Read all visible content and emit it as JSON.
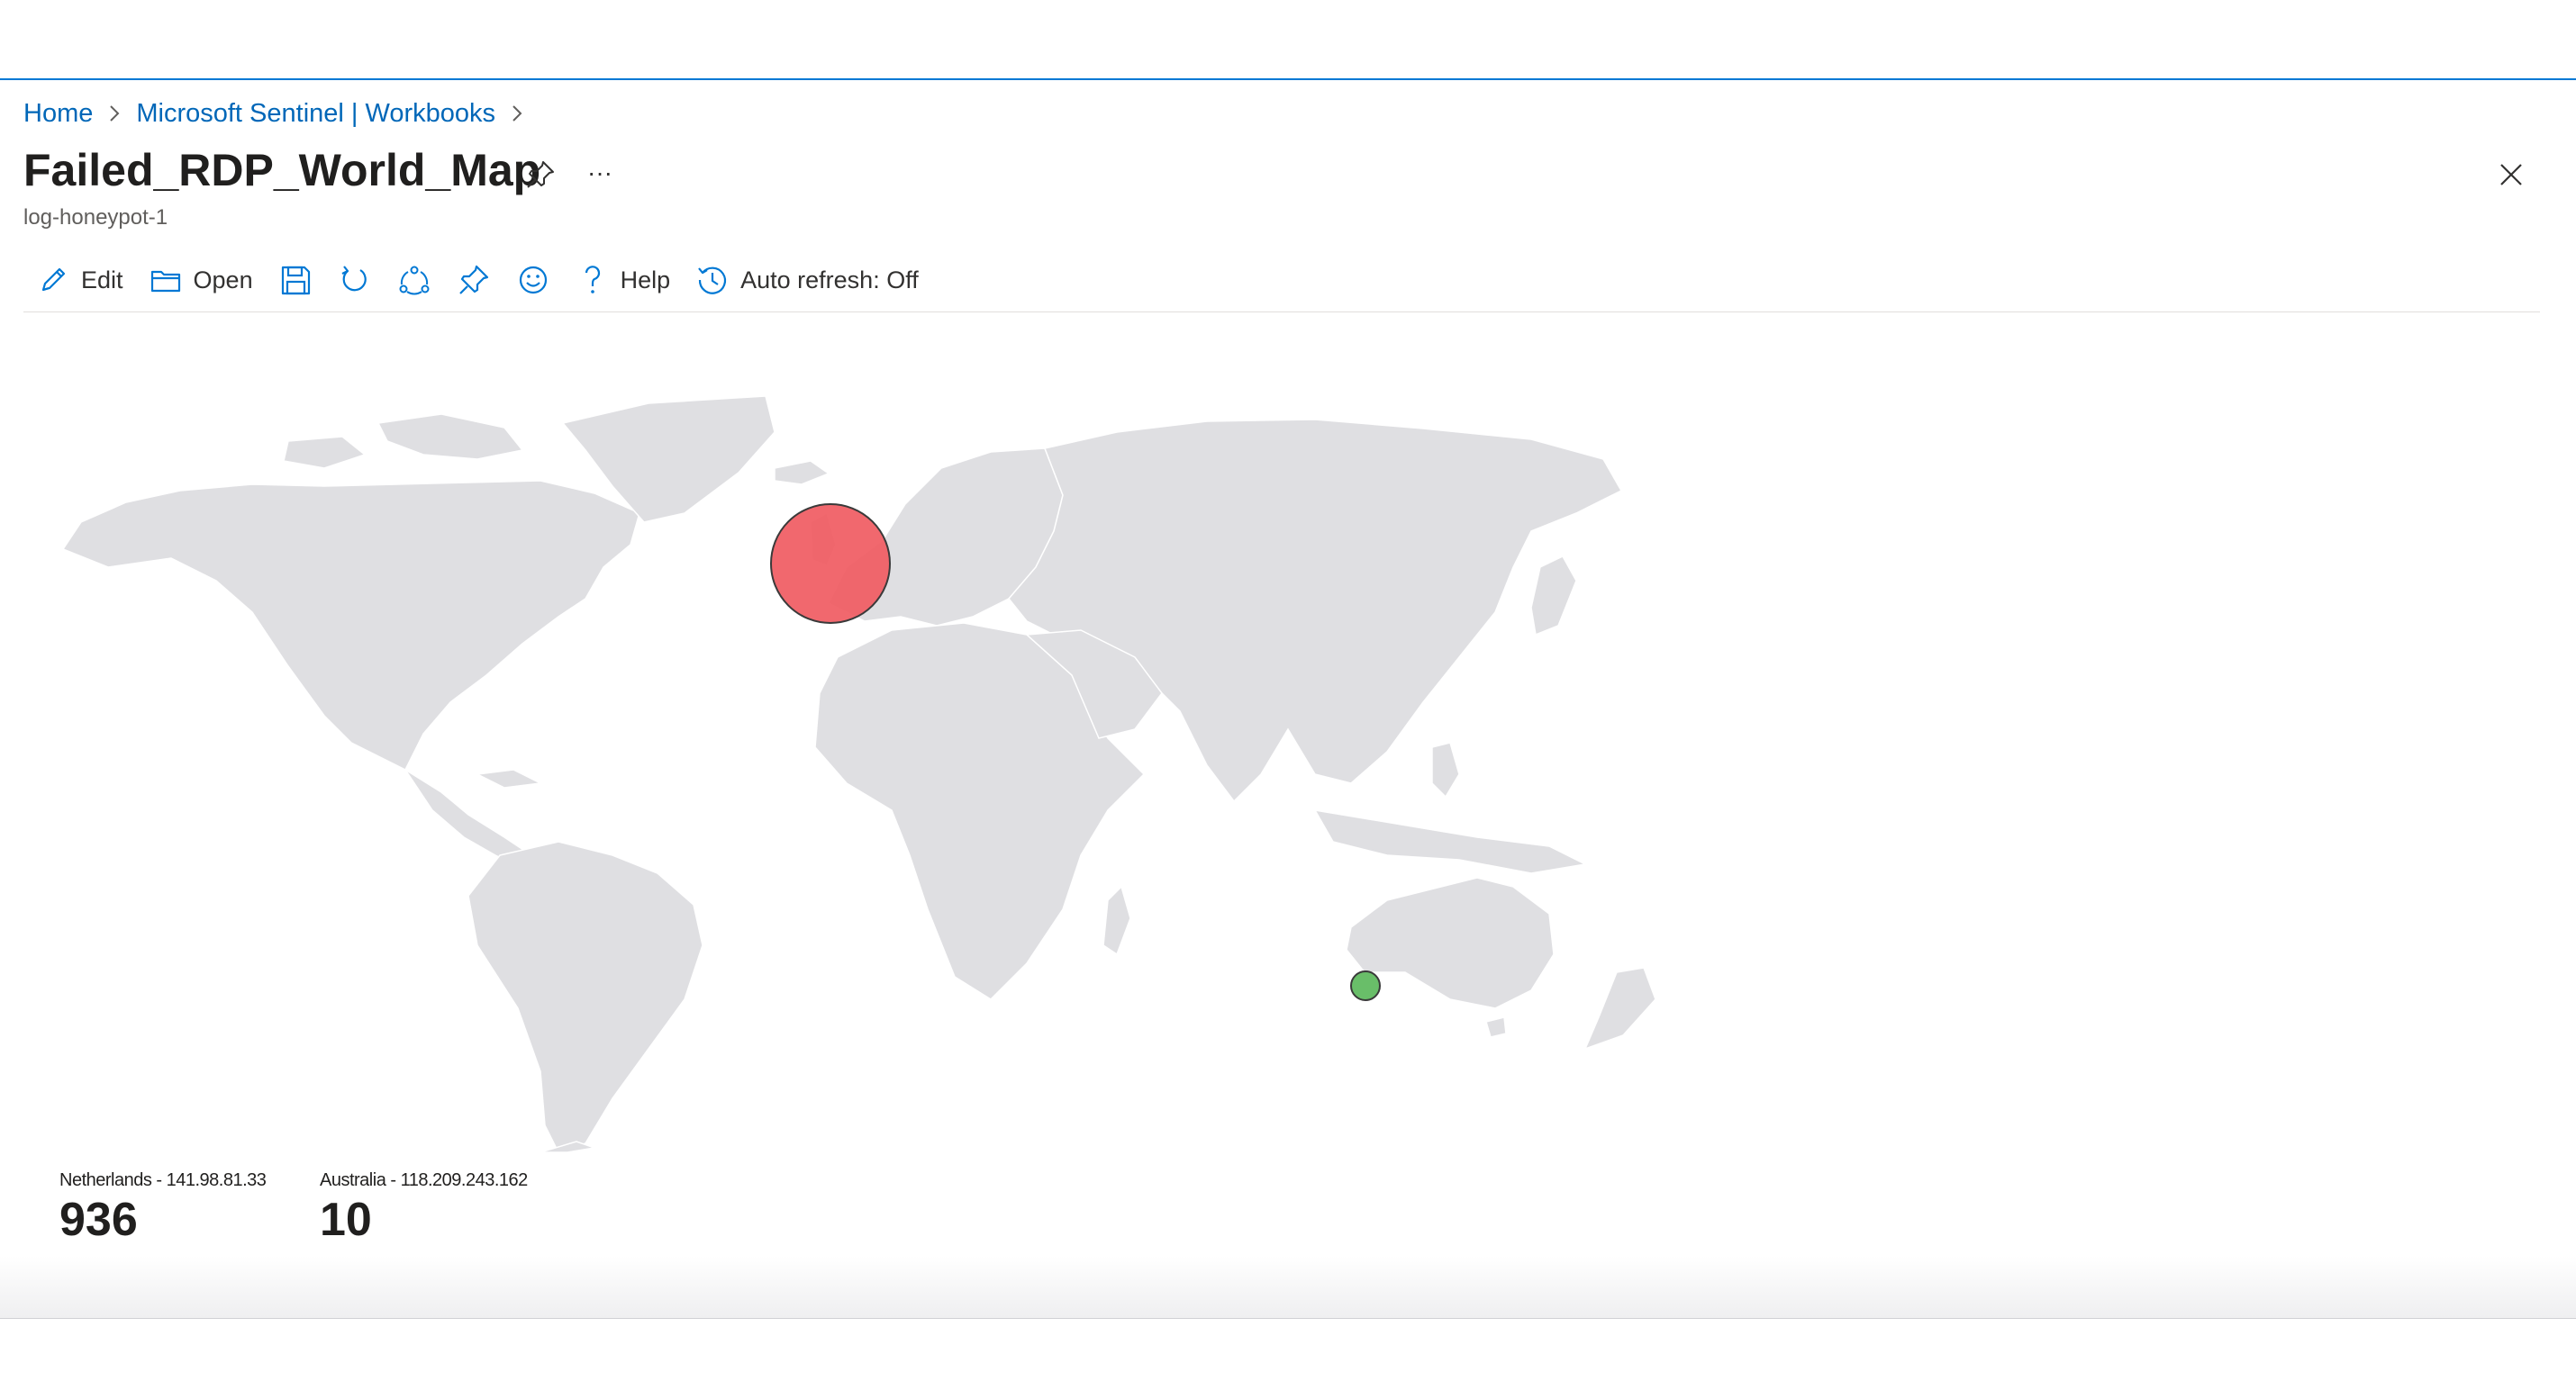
{
  "breadcrumb": {
    "home": "Home",
    "workbooks": "Microsoft Sentinel | Workbooks"
  },
  "header": {
    "title": "Failed_RDP_World_Map",
    "more_label": "···",
    "subtitle": "log-honeypot-1"
  },
  "toolbar": {
    "edit": "Edit",
    "open": "Open",
    "help": "Help",
    "auto_refresh": "Auto refresh: Off"
  },
  "map": {
    "points": [
      {
        "label": "Netherlands - 141.98.81.33",
        "country": "Netherlands",
        "ip": "141.98.81.33",
        "count": 936,
        "color": "#f05b62"
      },
      {
        "label": "Australia - 118.209.243.162",
        "country": "Australia",
        "ip": "118.209.243.162",
        "count": 10,
        "color": "#5cb85c"
      }
    ]
  },
  "colors": {
    "accent": "#0078d4",
    "link": "#0067b8",
    "land": "#dfdfe2",
    "high": "#f05b62",
    "low": "#5cb85c"
  },
  "icons": [
    "chevron-right-icon",
    "pin-icon",
    "more-icon",
    "close-icon",
    "edit-icon",
    "folder-open-icon",
    "save-icon",
    "refresh-icon",
    "share-icon",
    "pin-icon",
    "feedback-icon",
    "help-icon",
    "history-icon"
  ]
}
